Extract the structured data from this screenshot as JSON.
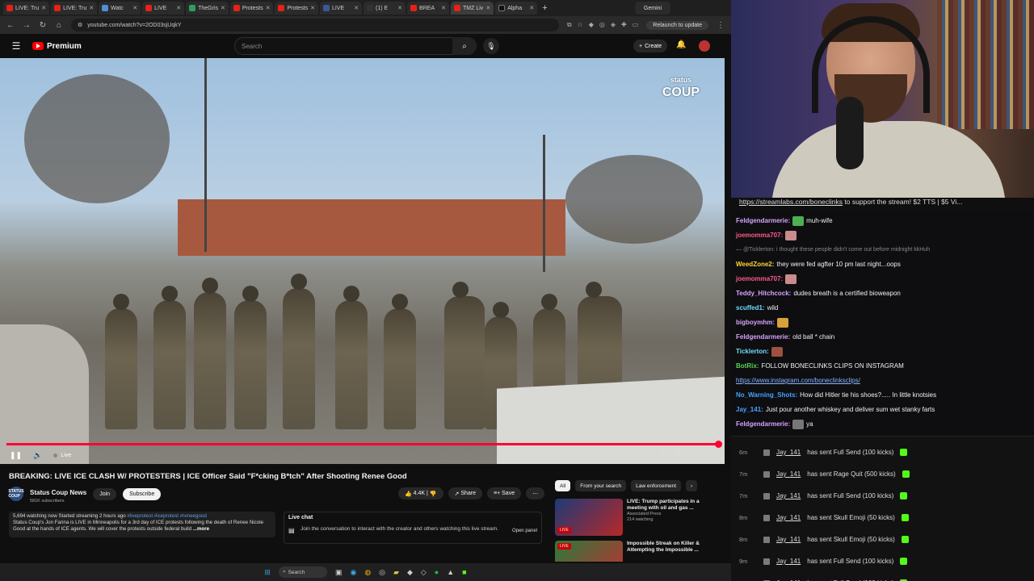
{
  "browser": {
    "tabs": [
      "LIVE: Tru",
      "LIVE: Tru",
      "Watc",
      "LIVE",
      "TheGris",
      "Protests",
      "Protests",
      "LIVE",
      "(1) E",
      "BREA",
      "TMZ Liv",
      "Alpha"
    ],
    "gemini_tab": "Gemini",
    "url": "youtube.com/watch?v=2OD03sjUqkY",
    "relaunch": "Relaunch to update"
  },
  "youtube": {
    "brand": "Premium",
    "search_placeholder": "Search",
    "create_label": "Create"
  },
  "video": {
    "overlay_logo_top": "status",
    "overlay_logo_bottom": "COUP",
    "live_label": "Live",
    "title": "BREAKING: LIVE ICE CLASH W/ PROTESTERS | ICE Officer Said \"F*cking B*tch\" After Shooting Renee Good",
    "channel_name": "Status Coup News",
    "channel_subs": "581K subscribers",
    "channel_avatar_text": "STATUS COUP",
    "join": "Join",
    "subscribe": "Subscribe",
    "likes": "4.4K",
    "share": "Share",
    "save": "Save",
    "desc_stats": "5,694 watching now  Started streaming 2 hours ago",
    "desc_tags": "#liveprotest #iceprotest #reneegood",
    "desc_body": "Status Coup's Jon Farina is LIVE in Minneapolis for a 3rd day of ICE protests following the death of Renee Nicole Good at the hands of ICE agents. We will cover the protests outside federal build",
    "desc_more": "...more",
    "live_chat_title": "Live chat",
    "live_chat_msg": "Join the conversation to interact with the creator and others watching this live stream.",
    "open_panel": "Open panel"
  },
  "recs": {
    "chips": [
      "All",
      "From your search",
      "Law enforcement"
    ],
    "items": [
      {
        "title": "LIVE: Trump participates in a meeting with oil and gas ...",
        "channel": "Associated Press",
        "meta": "214 watching",
        "badge": "LIVE"
      },
      {
        "title": "Impossible Streak on Killer & Attempting the Impossible ...",
        "channel": "",
        "meta": "",
        "badge": "LIVE"
      }
    ]
  },
  "taskbar": {
    "search": "Search"
  },
  "stream": {
    "ticker_link": "https://streamlabs.com/boneclinks",
    "ticker_text": " to support the stream! $2 TTS | $5 Vi..."
  },
  "chat": [
    {
      "user": "Feldgendarmerie:",
      "user_color": "#d6a3ff",
      "text": "muh-wife",
      "emote": "#4caf50"
    },
    {
      "user": "joemomma707:",
      "user_color": "#ff5a8a",
      "text": "",
      "emote": "#c98b8b"
    },
    {
      "user": "",
      "user_color": "#888",
      "text": "— @Ticklerton: i thought these people didn't come out before midnight kkHuh",
      "emote": ""
    },
    {
      "user": "WeedZone2:",
      "user_color": "#ffd43b",
      "text": "they were fed agfter 10 pm last night...oops",
      "emote": ""
    },
    {
      "user": "joemomma707:",
      "user_color": "#ff5a8a",
      "text": "",
      "emote": "#c98b8b"
    },
    {
      "user": "Teddy_Hitchcock:",
      "user_color": "#d6a3ff",
      "text": "dudes breath is a certified bioweapon",
      "emote": ""
    },
    {
      "user": "scuffed1:",
      "user_color": "#6fdcff",
      "text": "wild",
      "emote": ""
    },
    {
      "user": "bigboymhm:",
      "user_color": "#d6a3ff",
      "text": "",
      "emote": "#d8a13a"
    },
    {
      "user": "Feldgendarmerie:",
      "user_color": "#d6a3ff",
      "text": "old ball * chain",
      "emote": ""
    },
    {
      "user": "Ticklerton:",
      "user_color": "#6fdcff",
      "text": "",
      "emote": "#a05040"
    },
    {
      "user": "BotRix:",
      "user_color": "#5ad25a",
      "text": "FOLLOW BONECLINKS CLIPS ON INSTAGRAM",
      "emote": ""
    },
    {
      "user": "",
      "user_color": "#8ab4ff",
      "text": "https://www.instagram.com/boneclinksclips/",
      "emote": ""
    },
    {
      "user": "No_Warning_Shots:",
      "user_color": "#45a3ff",
      "text": "How did Hitler tie his shoes?..... In little knotsies",
      "emote": ""
    },
    {
      "user": "Jay_141:",
      "user_color": "#45a3ff",
      "text": "Just pour another whiskey and deliver sum wet stanky farts",
      "emote": ""
    },
    {
      "user": "Feldgendarmerie:",
      "user_color": "#d6a3ff",
      "text": "ya",
      "emote": "#777"
    }
  ],
  "events": [
    {
      "time": "6m",
      "user": "Jay_141",
      "text": "has sent Full Send (100 kicks)"
    },
    {
      "time": "7m",
      "user": "Jay_141",
      "text": "has sent Rage Quit (500 kicks)"
    },
    {
      "time": "7m",
      "user": "Jay_141",
      "text": "has sent Full Send (100 kicks)"
    },
    {
      "time": "8m",
      "user": "Jay_141",
      "text": "has sent Skull Emoji (50 kicks)"
    },
    {
      "time": "8m",
      "user": "Jay_141",
      "text": "has sent Skull Emoji (50 kicks)"
    },
    {
      "time": "9m",
      "user": "Jay_141",
      "text": "has sent Full Send (100 kicks)"
    },
    {
      "time": "9m",
      "user": "Jay_141",
      "text": "has sent Full Send (100 kicks)"
    }
  ]
}
